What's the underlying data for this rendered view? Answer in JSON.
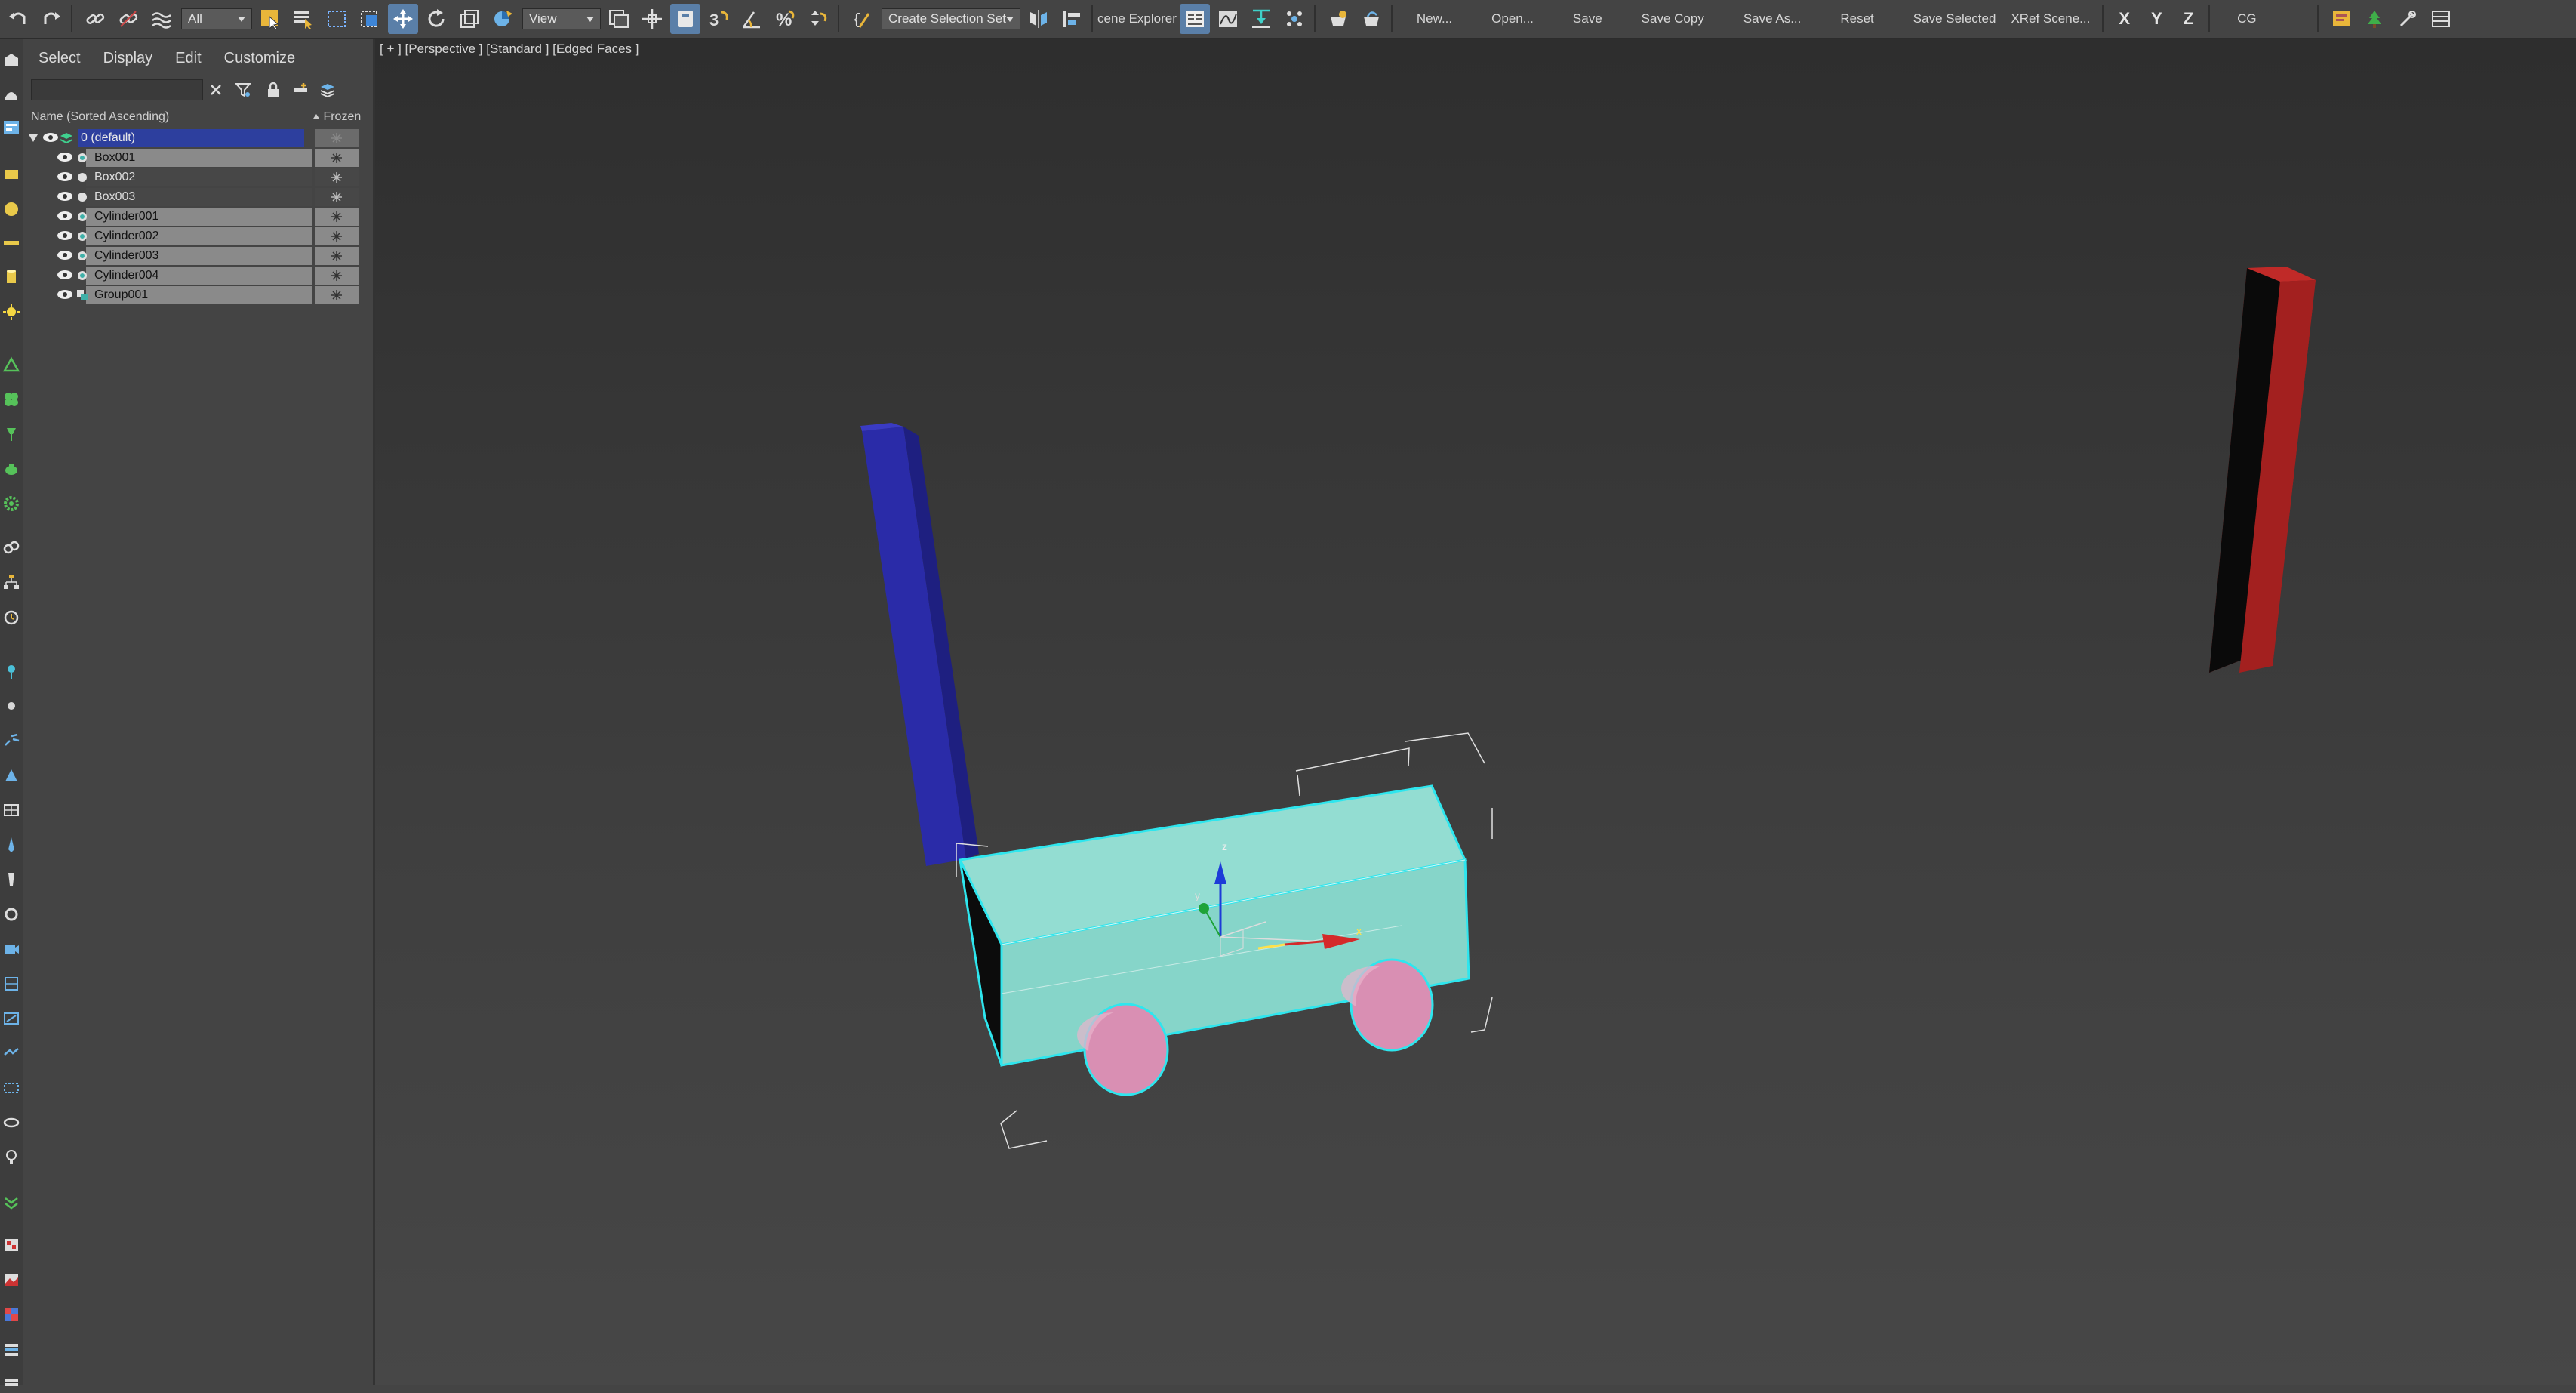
{
  "toolbar": {
    "selection_filter": "All",
    "view_dropdown": "View",
    "snap_label": "3",
    "named_selection": "Create Selection Set",
    "scene_explorer_label": "cene Explorer",
    "commands": [
      "New...",
      "Open...",
      "Save",
      "Save Copy",
      "Save As...",
      "Reset",
      "Save Selected",
      "XRef Scene..."
    ],
    "axes": [
      "X",
      "Y",
      "Z"
    ],
    "cg_label": "CG"
  },
  "explorer": {
    "menus": [
      "Select",
      "Display",
      "Edit",
      "Customize"
    ],
    "search_placeholder": "",
    "col_name": "Name (Sorted Ascending)",
    "col_frozen": "Frozen",
    "layer": "0 (default)",
    "objects": [
      "Box001",
      "Box002",
      "Box003",
      "Cylinder001",
      "Cylinder002",
      "Cylinder003",
      "Cylinder004",
      "Group001"
    ]
  },
  "viewport": {
    "label": "[ + ] [Perspective ] [Standard ] [Edged Faces ]",
    "gizmo_axes": {
      "x": "x",
      "y": "y",
      "z": "z"
    }
  },
  "colors": {
    "selected_box": "#8ed8cc",
    "blue_post": "#2a2ba8",
    "red_post": "#a3201f",
    "wheel": "#d98fb3",
    "layer_highlight": "#2d3f9e"
  }
}
